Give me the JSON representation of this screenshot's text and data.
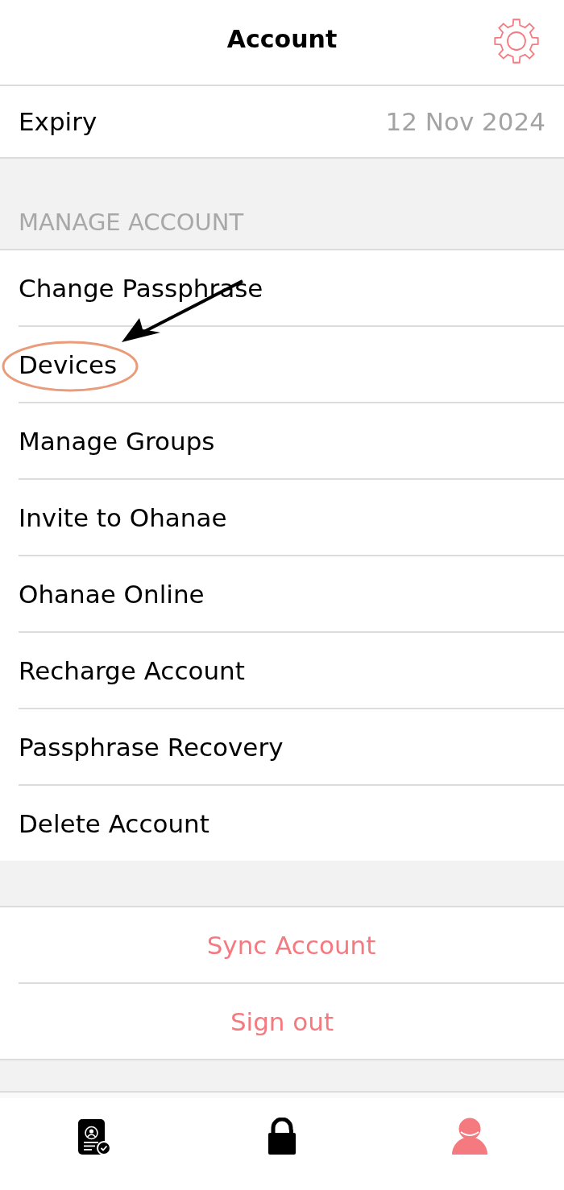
{
  "header": {
    "title": "Account"
  },
  "expiry": {
    "label": "Expiry",
    "value": "12 Nov 2024"
  },
  "manage_section": {
    "title": "MANAGE ACCOUNT",
    "items": [
      {
        "label": "Change Passphrase",
        "highlighted": false
      },
      {
        "label": "Devices",
        "highlighted": true
      },
      {
        "label": "Manage Groups",
        "highlighted": false
      },
      {
        "label": "Invite to Ohanae",
        "highlighted": false
      },
      {
        "label": "Ohanae Online",
        "highlighted": false
      },
      {
        "label": "Recharge Account",
        "highlighted": false
      },
      {
        "label": "Passphrase Recovery",
        "highlighted": false
      },
      {
        "label": "Delete Account",
        "highlighted": false
      }
    ]
  },
  "actions": [
    {
      "label": "Sync Account"
    },
    {
      "label": "Sign out"
    }
  ],
  "tab_bar": [
    {
      "kind": "profile-document",
      "selected": false
    },
    {
      "kind": "lock",
      "selected": false
    },
    {
      "kind": "person",
      "selected": true
    }
  ]
}
